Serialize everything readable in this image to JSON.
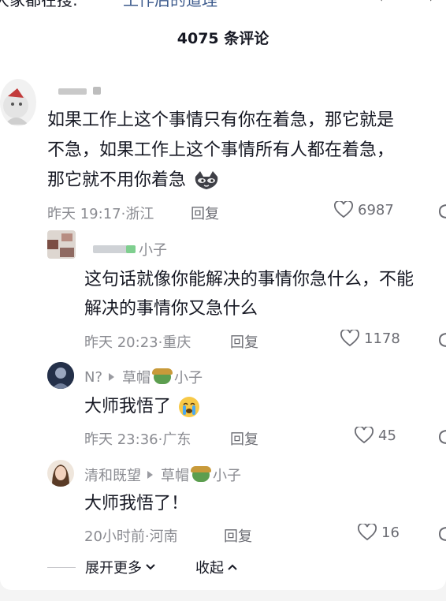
{
  "top": {
    "plain_text": "大家都在搜:",
    "link_text": "工作后的道理",
    "chev1": "‹",
    "chev2": "›"
  },
  "header": {
    "title": "4075 条评论"
  },
  "comments": [
    {
      "lines": [
        "如果工作上这个事情只有你在着急，那它就是",
        "不急，如果工作上这个事情所有人都在着急，",
        "那它就不用你着急"
      ],
      "time": "昨天 19:17",
      "loc": "浙江",
      "reply_label": "回复",
      "likes": "6987"
    }
  ],
  "replies": [
    {
      "name_suffix": "小子",
      "lines": [
        "这句话就像你能解决的事情你急什么，不能",
        "解决的事情你又急什么"
      ],
      "time": "昨天 20:23",
      "loc": "重庆",
      "reply_label": "回复",
      "likes": "1178"
    },
    {
      "name": "N?",
      "target": "草帽",
      "target_suffix": "小子",
      "lines": [
        "大师我悟了"
      ],
      "time": "昨天 23:36",
      "loc": "广东",
      "reply_label": "回复",
      "likes": "45"
    },
    {
      "name": "清和既望",
      "target": "草帽",
      "target_suffix": "小子",
      "lines": [
        "大师我悟了！"
      ],
      "time": "20小时前",
      "loc": "河南",
      "reply_label": "回复",
      "likes": "16"
    }
  ],
  "footer": {
    "expand_label": "展开更多",
    "collapse_label": "收起"
  },
  "colors": {
    "link": "#3c5a8c",
    "meta": "#8a8b91",
    "text": "#161823"
  }
}
